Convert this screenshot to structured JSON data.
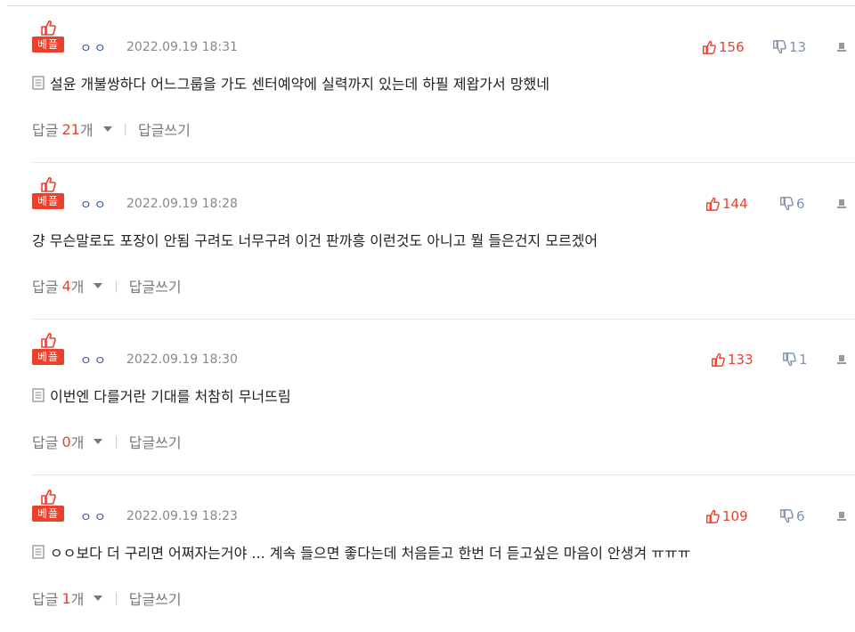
{
  "comments": [
    {
      "badge": "베플",
      "nick": "ㅇㅇ",
      "date": "2022.09.19 18:31",
      "likes": "156",
      "dislikes": "13",
      "has_doc_icon": true,
      "text": "설윤 개불쌍하다 어느그룹을 가도 센터예약에 실력까지 있는데 하필 제왑가서 망했네",
      "reply_label": "답글",
      "reply_count": "21",
      "reply_unit": "개",
      "write_label": "답글쓰기"
    },
    {
      "badge": "베플",
      "nick": "ㅇㅇ",
      "date": "2022.09.19 18:28",
      "likes": "144",
      "dislikes": "6",
      "has_doc_icon": false,
      "text": "걍 무슨말로도 포장이 안됨 구려도 너무구려 이건 판까흥 이런것도 아니고 뭘 들은건지 모르겠어",
      "reply_label": "답글",
      "reply_count": "4",
      "reply_unit": "개",
      "write_label": "답글쓰기"
    },
    {
      "badge": "베플",
      "nick": "ㅇㅇ",
      "date": "2022.09.19 18:30",
      "likes": "133",
      "dislikes": "1",
      "has_doc_icon": true,
      "text": "이번엔 다를거란 기대를 처참히 무너뜨림",
      "reply_label": "답글",
      "reply_count": "0",
      "reply_unit": "개",
      "write_label": "답글쓰기"
    },
    {
      "badge": "베플",
      "nick": "ㅇㅇ",
      "date": "2022.09.19 18:23",
      "likes": "109",
      "dislikes": "6",
      "has_doc_icon": true,
      "text": "ㅇㅇ보다 더 구리면 어쩌자는거야 ... 계속 들으면 좋다는데 처음듣고 한번 더 듣고싶은 마음이 안생겨 ㅠㅠㅠ",
      "reply_label": "답글",
      "reply_count": "1",
      "reply_unit": "개",
      "write_label": "답글쓰기"
    }
  ],
  "icons": {
    "like": "thumbs-up-icon",
    "dislike": "thumbs-down-icon",
    "report": "report-icon",
    "doc": "document-icon",
    "caret": "caret-down-icon"
  },
  "colors": {
    "accent": "#e8422e",
    "nick": "#2f4fb4",
    "dislike": "#7f93ad",
    "muted": "#777777"
  }
}
